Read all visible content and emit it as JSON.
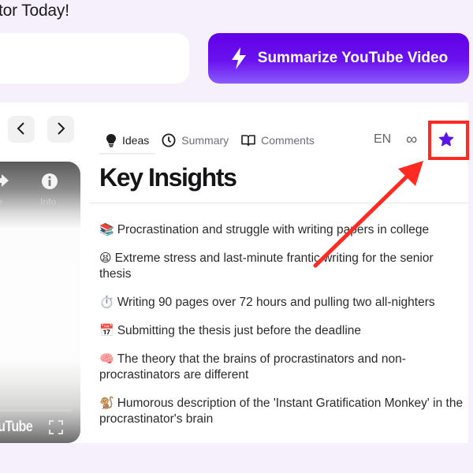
{
  "header": {
    "headline": "tor Today!"
  },
  "url_input": {
    "value": "",
    "placeholder": ""
  },
  "summarize_button": {
    "label": "Summarize YouTube Video",
    "icon": "lightning-bolt-icon"
  },
  "video_player": {
    "share_label": "are",
    "info_label": "Info",
    "logo_text": "ouTube"
  },
  "tabs": [
    {
      "label": "Ideas",
      "icon": "lightbulb-icon",
      "active": true
    },
    {
      "label": "Summary",
      "icon": "clock-icon",
      "active": false
    },
    {
      "label": "Comments",
      "icon": "book-icon",
      "active": false
    }
  ],
  "toolbar": {
    "language": "EN",
    "infinity_symbol": "∞",
    "star_icon": "star-icon"
  },
  "content": {
    "title": "Key Insights",
    "insights": [
      {
        "emoji": "📚",
        "text": "Procrastination and struggle with writing papers in college"
      },
      {
        "emoji": "😫",
        "text": "Extreme stress and last-minute frantic writing for the senior thesis"
      },
      {
        "emoji": "⏱️",
        "text": "Writing 90 pages over 72 hours and pulling two all-nighters"
      },
      {
        "emoji": "📅",
        "text": "Submitting the thesis just before the deadline"
      },
      {
        "emoji": "🧠",
        "text": "The theory that the brains of procrastinators and non-procrastinators are different"
      },
      {
        "emoji": "🐒",
        "text": "Humorous description of the 'Instant Gratification Monkey' in the procrastinator's brain"
      }
    ]
  },
  "colors": {
    "background": "#f6f0fc",
    "brand_purple": "#6100e6",
    "star": "#5b14e8",
    "annotation_red": "#ff2a22"
  }
}
